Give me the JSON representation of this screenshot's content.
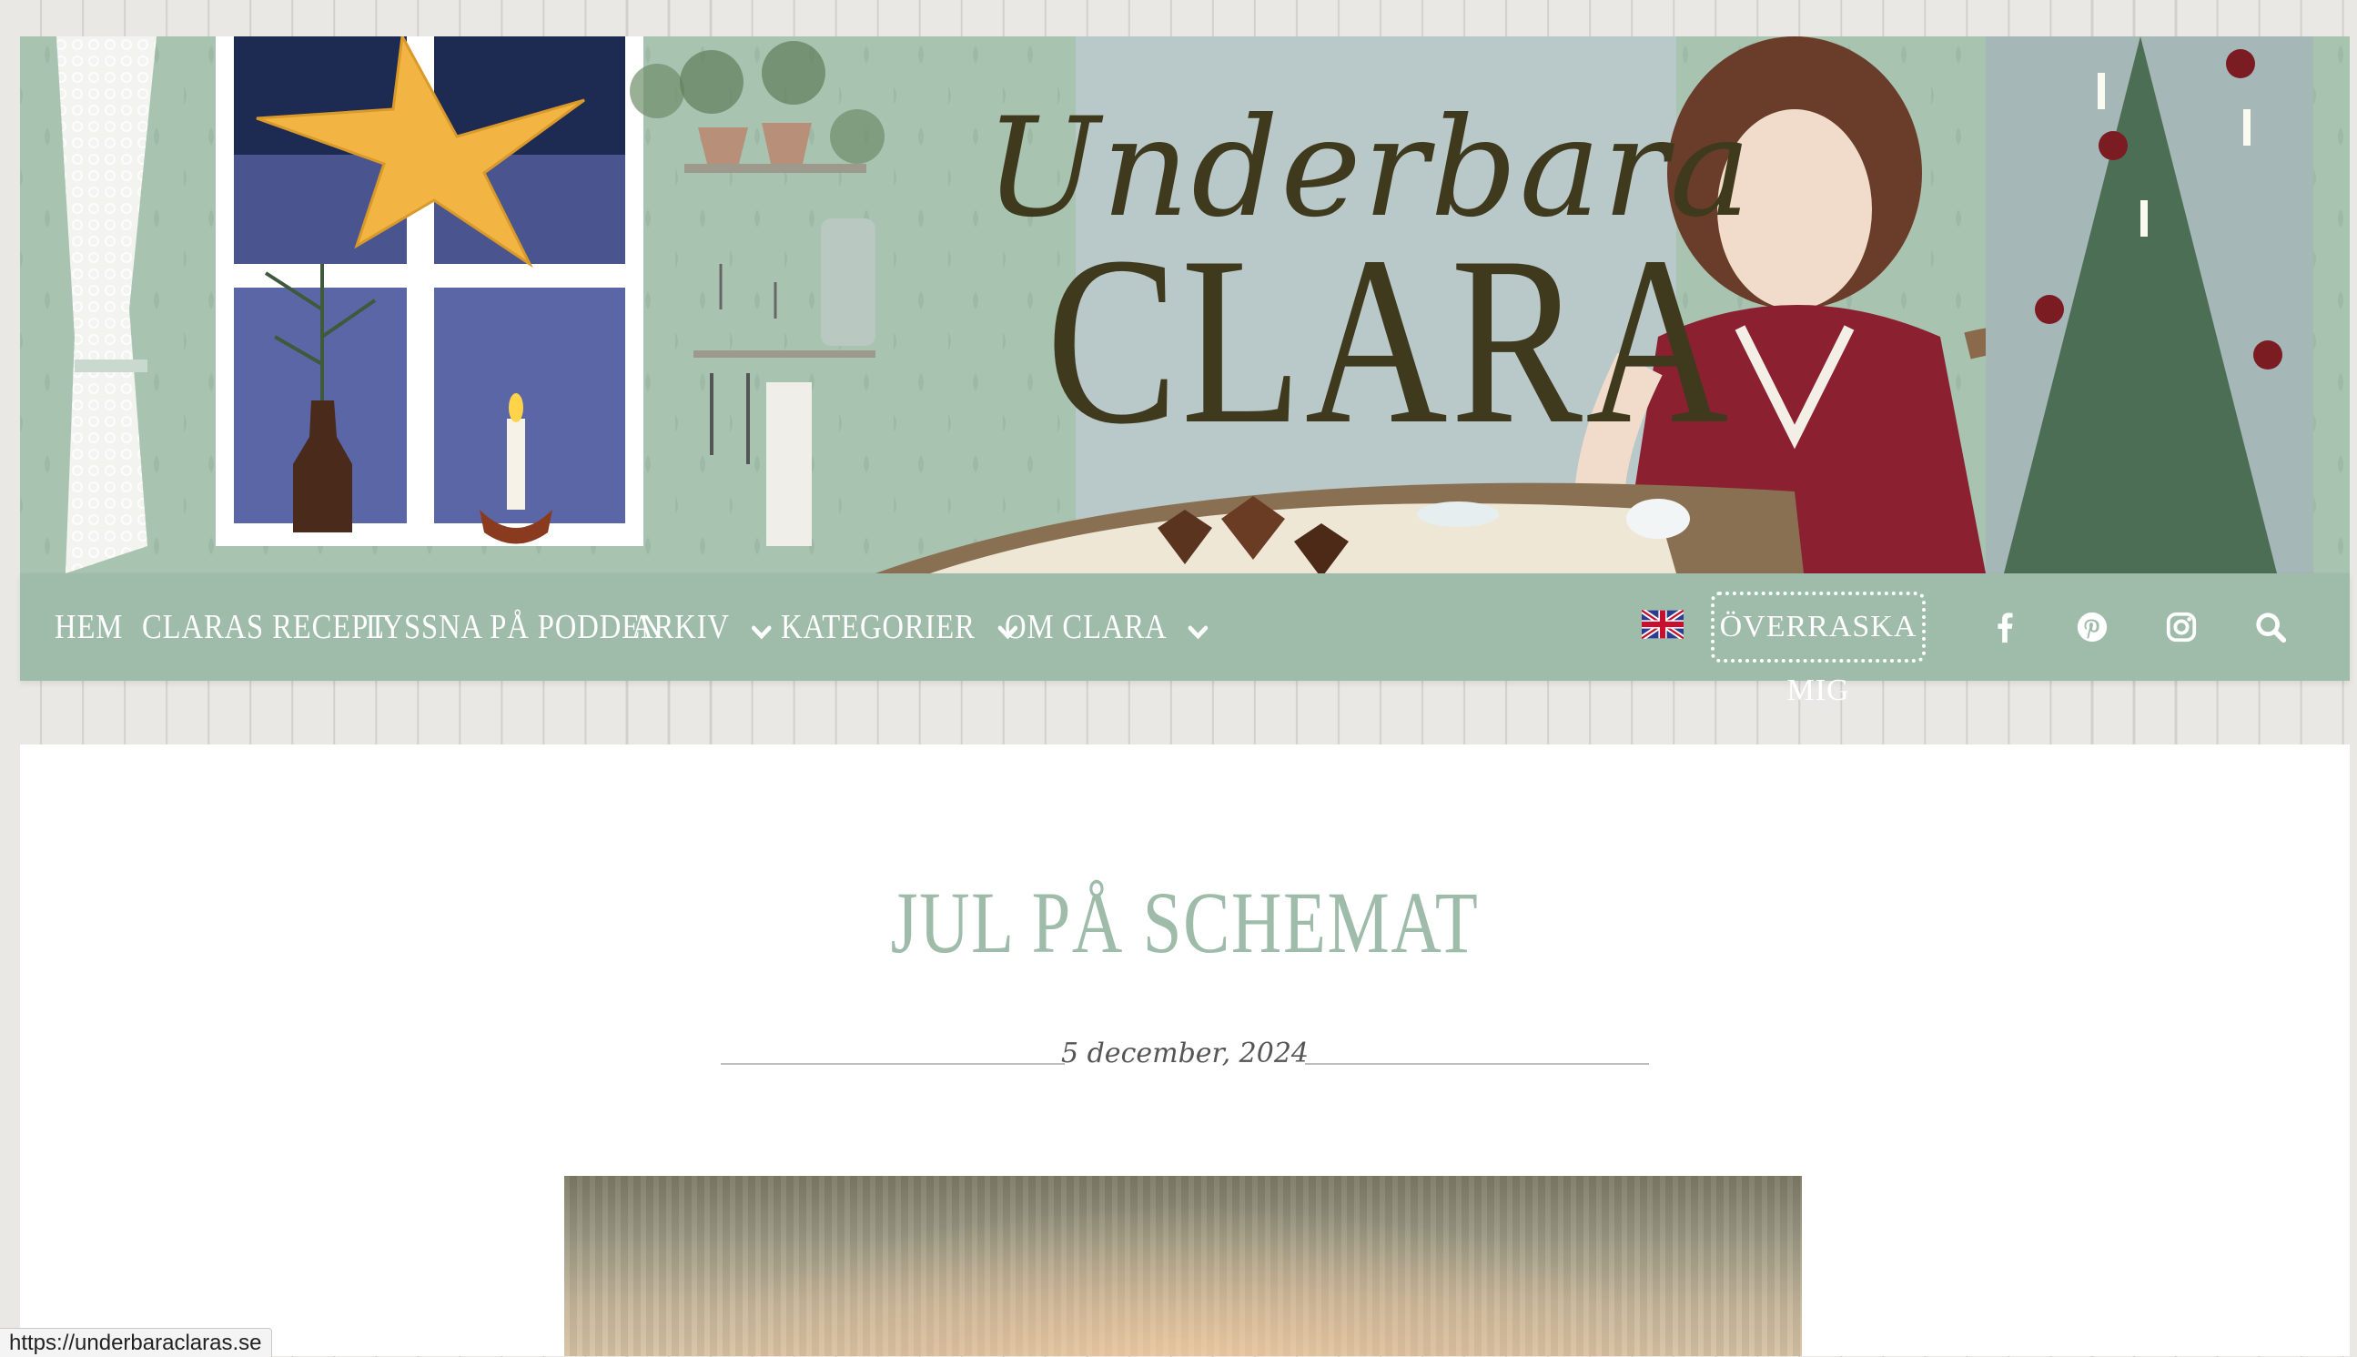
{
  "header": {
    "logo_script": "Underbara",
    "logo_main": "CLARA"
  },
  "nav": {
    "items": [
      {
        "label": "HEM",
        "dropdown": false
      },
      {
        "label": "CLARAS RECEPT",
        "dropdown": false
      },
      {
        "label": "LYSSNA PÅ PODDEN",
        "dropdown": false
      },
      {
        "label": "ARKIV",
        "dropdown": true
      },
      {
        "label": "KATEGORIER",
        "dropdown": true
      },
      {
        "label": "OM CLARA",
        "dropdown": true
      }
    ],
    "language_flag": "uk-flag-icon",
    "surprise_label": "ÖVERRASKA MIG",
    "social_icons": [
      "facebook-icon",
      "pinterest-icon",
      "instagram-icon",
      "search-icon"
    ]
  },
  "post": {
    "title": "JUL PÅ SCHEMAT",
    "date": "5 december, 2024"
  },
  "status_bar": {
    "url": "https://underbaraclaras.se"
  },
  "colors": {
    "nav_green": "#9ebca9",
    "title_green": "#9ebca9",
    "logo_brown": "#3f3a1e",
    "page_bg": "#e9e8e4"
  }
}
